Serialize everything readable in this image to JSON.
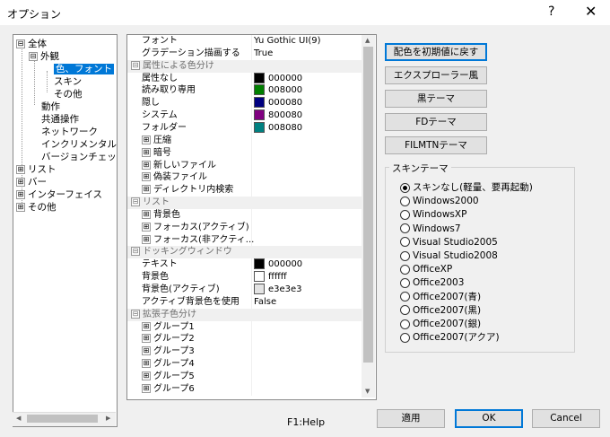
{
  "window": {
    "title": "オプション",
    "help": "?",
    "close": "✕"
  },
  "tree": {
    "items": [
      {
        "label": "全体",
        "expander": "⊟"
      },
      {
        "label": "外観",
        "expander": "⊟"
      },
      {
        "label": "色、フォント",
        "selected": true
      },
      {
        "label": "スキン"
      },
      {
        "label": "その他"
      },
      {
        "label": "動作"
      },
      {
        "label": "共通操作"
      },
      {
        "label": "ネットワーク"
      },
      {
        "label": "インクリメンタルサー"
      },
      {
        "label": "バージョンチェック"
      },
      {
        "label": "リスト",
        "expander": "⊞"
      },
      {
        "label": "バー",
        "expander": "⊞"
      },
      {
        "label": "インターフェイス",
        "expander": "⊞"
      },
      {
        "label": "その他",
        "expander": "⊞"
      }
    ]
  },
  "grid": {
    "rows": [
      {
        "type": "prop",
        "k": "フォント",
        "v": "Yu Gothic UI(9)",
        "indent": 0
      },
      {
        "type": "prop",
        "k": "グラデーション描画する",
        "v": "True",
        "indent": 0
      },
      {
        "type": "cat",
        "k": "属性による色分け",
        "exp": "⊟"
      },
      {
        "type": "prop",
        "k": "属性なし",
        "v": "000000",
        "color": "#000000"
      },
      {
        "type": "prop",
        "k": "読み取り専用",
        "v": "008000",
        "color": "#008000"
      },
      {
        "type": "prop",
        "k": "隠し",
        "v": "000080",
        "color": "#000080"
      },
      {
        "type": "prop",
        "k": "システム",
        "v": "800080",
        "color": "#800080"
      },
      {
        "type": "prop",
        "k": "フォルダー",
        "v": "008080",
        "color": "#008080"
      },
      {
        "type": "sub",
        "k": "圧縮",
        "exp": "⊞"
      },
      {
        "type": "sub",
        "k": "暗号",
        "exp": "⊞"
      },
      {
        "type": "sub",
        "k": "新しいファイル",
        "exp": "⊞"
      },
      {
        "type": "sub",
        "k": "偽装ファイル",
        "exp": "⊞"
      },
      {
        "type": "sub",
        "k": "ディレクトリ内検索",
        "exp": "⊞"
      },
      {
        "type": "cat",
        "k": "リスト",
        "exp": "⊟"
      },
      {
        "type": "sub",
        "k": "背景色",
        "exp": "⊞"
      },
      {
        "type": "sub",
        "k": "フォーカス(アクティブ)",
        "exp": "⊞"
      },
      {
        "type": "sub",
        "k": "フォーカス(非アクティ...",
        "exp": "⊞"
      },
      {
        "type": "cat",
        "k": "ドッキングウィンドウ",
        "exp": "⊟"
      },
      {
        "type": "prop",
        "k": "テキスト",
        "v": "000000",
        "color": "#000000"
      },
      {
        "type": "prop",
        "k": "背景色",
        "v": "ffffff",
        "color": "#ffffff"
      },
      {
        "type": "prop",
        "k": "背景色(アクティブ)",
        "v": "e3e3e3",
        "color": "#e3e3e3"
      },
      {
        "type": "prop",
        "k": "アクティブ背景色を使用",
        "v": "False"
      },
      {
        "type": "cat",
        "k": "拡張子色分け",
        "exp": "⊟"
      },
      {
        "type": "sub",
        "k": "グループ1",
        "exp": "⊞"
      },
      {
        "type": "sub",
        "k": "グループ2",
        "exp": "⊞"
      },
      {
        "type": "sub",
        "k": "グループ3",
        "exp": "⊞"
      },
      {
        "type": "sub",
        "k": "グループ4",
        "exp": "⊞"
      },
      {
        "type": "sub",
        "k": "グループ5",
        "exp": "⊞"
      },
      {
        "type": "sub",
        "k": "グループ6",
        "exp": "⊞"
      }
    ],
    "scroll_up": "▲",
    "scroll_down": "▼",
    "hscroll_left": "◀",
    "hscroll_right": "▶"
  },
  "status": {
    "f1": "F1:Help"
  },
  "buttons": {
    "reset_colors": "配色を初期値に戻す",
    "explorer": "エクスプローラー風",
    "dark": "黒テーマ",
    "fd": "FDテーマ",
    "filmtn": "FILMTNテーマ",
    "apply": "適用",
    "ok": "OK",
    "cancel": "Cancel"
  },
  "skin": {
    "title": "スキンテーマ",
    "options": [
      {
        "label": "スキンなし(軽量、要再起動)",
        "checked": true
      },
      {
        "label": "Windows2000"
      },
      {
        "label": "WindowsXP"
      },
      {
        "label": "Windows7"
      },
      {
        "label": "Visual Studio2005"
      },
      {
        "label": "Visual Studio2008"
      },
      {
        "label": "OfficeXP"
      },
      {
        "label": "Office2003"
      },
      {
        "label": "Office2007(青)"
      },
      {
        "label": "Office2007(黒)"
      },
      {
        "label": "Office2007(銀)"
      },
      {
        "label": "Office2007(アクア)"
      }
    ]
  }
}
